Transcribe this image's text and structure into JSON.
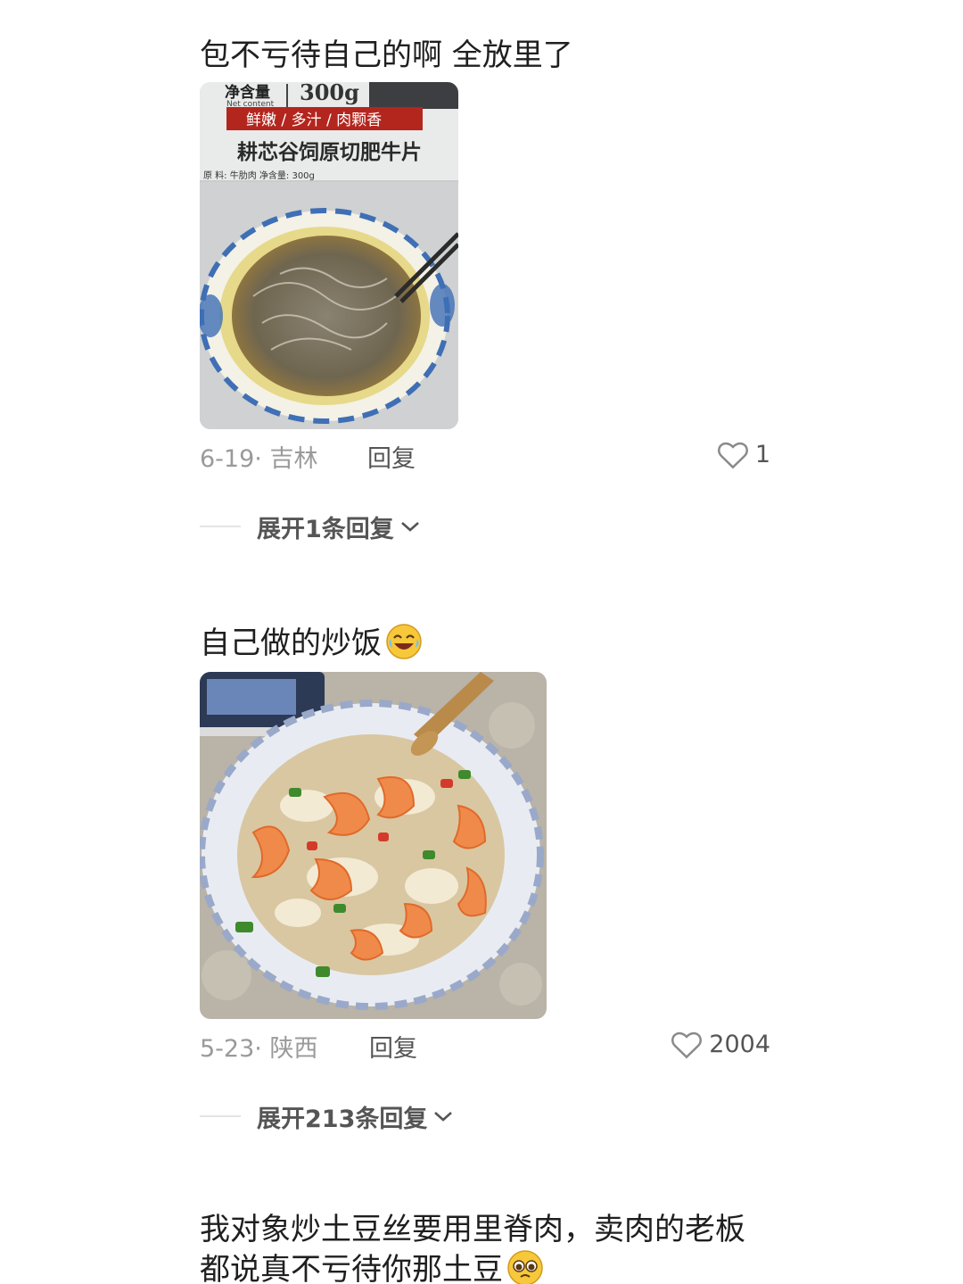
{
  "comments": [
    {
      "text": "包不亏待自己的啊 全放里了",
      "date_location": "6-19· 吉林",
      "reply_label": "回复",
      "likes": "1",
      "expand_label": "展开1条回复",
      "photo": {
        "package_net_label": "净含量",
        "package_net_en": "Net content",
        "package_weight": "300g",
        "package_tagline": "鲜嫩 / 多汁 / 肉颗香",
        "package_product": "耕芯谷饲原切肥牛片",
        "package_ingredients": "原 料: 牛肋肉 净含量: 300g"
      }
    },
    {
      "text": "自己做的炒饭",
      "emoji": "laughing-crying-emoji",
      "date_location": "5-23· 陕西",
      "reply_label": "回复",
      "likes": "2004",
      "expand_label": "展开213条回复"
    },
    {
      "text_line1": "我对象炒土豆丝要用里脊肉，卖肉的老板",
      "text_line2": "都说真不亏待你那土豆",
      "emoji": "pleading-face-emoji"
    }
  ],
  "colors": {
    "meta": "#9a9a9a",
    "text": "#1f1f1f",
    "action": "#555555"
  }
}
